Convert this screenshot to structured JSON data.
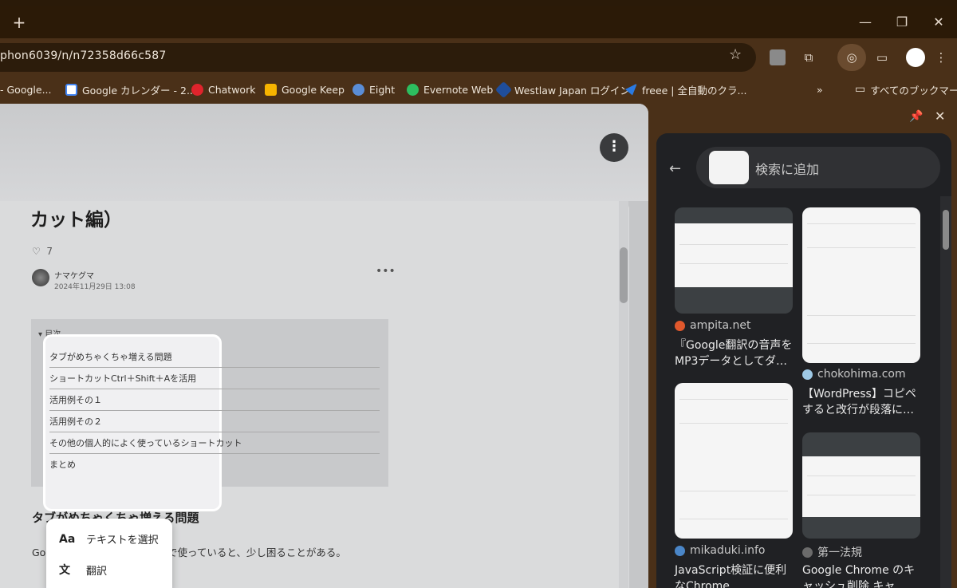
{
  "window": {
    "new_tab": "+",
    "minimize": "—",
    "restore": "❐",
    "close": "✕"
  },
  "toolbar": {
    "url": "phon6039/n/n72358d66c587"
  },
  "bookmarks": [
    {
      "label": "- Google..."
    },
    {
      "label": "Google カレンダー - 2..."
    },
    {
      "label": "Chatwork"
    },
    {
      "label": "Google Keep"
    },
    {
      "label": "Eight"
    },
    {
      "label": "Evernote Web"
    },
    {
      "label": "Westlaw Japan ログイン"
    },
    {
      "label": "freee | 全自動のクラ..."
    }
  ],
  "bookmarks_more": "»",
  "bookmarks_all": "すべてのブックマーク",
  "article": {
    "title": "カット編）",
    "likes": "7",
    "author": "ナマケグマ",
    "date": "2024年11月29日 13:08",
    "toc_heading": "目次",
    "toc": [
      "タブがめちゃくちゃ増える問題",
      "ショートカットCtrl＋Shift＋Aを活用",
      "活用例その１",
      "活用例その２",
      "その他の個人的によく使っているショートカット",
      "まとめ"
    ],
    "h2": "タブがめちゃくちゃ増える問題",
    "body_prefix": "Goo",
    "body_suffix": "業務で使っていると、少し困ることがある。"
  },
  "context_menu": {
    "select_text": "テキストを選択",
    "translate": "翻訳"
  },
  "side_panel": {
    "search_label": "検索に追加",
    "results": [
      {
        "site": "ampita.net",
        "title": "『Google翻訳の音声をMP3データとしてダ…"
      },
      {
        "site": "chokohima.com",
        "title": "【WordPress】コピペすると改行が段落に…"
      },
      {
        "site": "mikaduki.info",
        "title": "JavaScript検証に便利なChrome"
      },
      {
        "site": "第一法規",
        "title": "Google Chrome のキャッシュ削除 キャ…"
      }
    ]
  },
  "colors": {
    "chrome_frame": "#4a3018",
    "side_panel_bg": "#202124"
  }
}
